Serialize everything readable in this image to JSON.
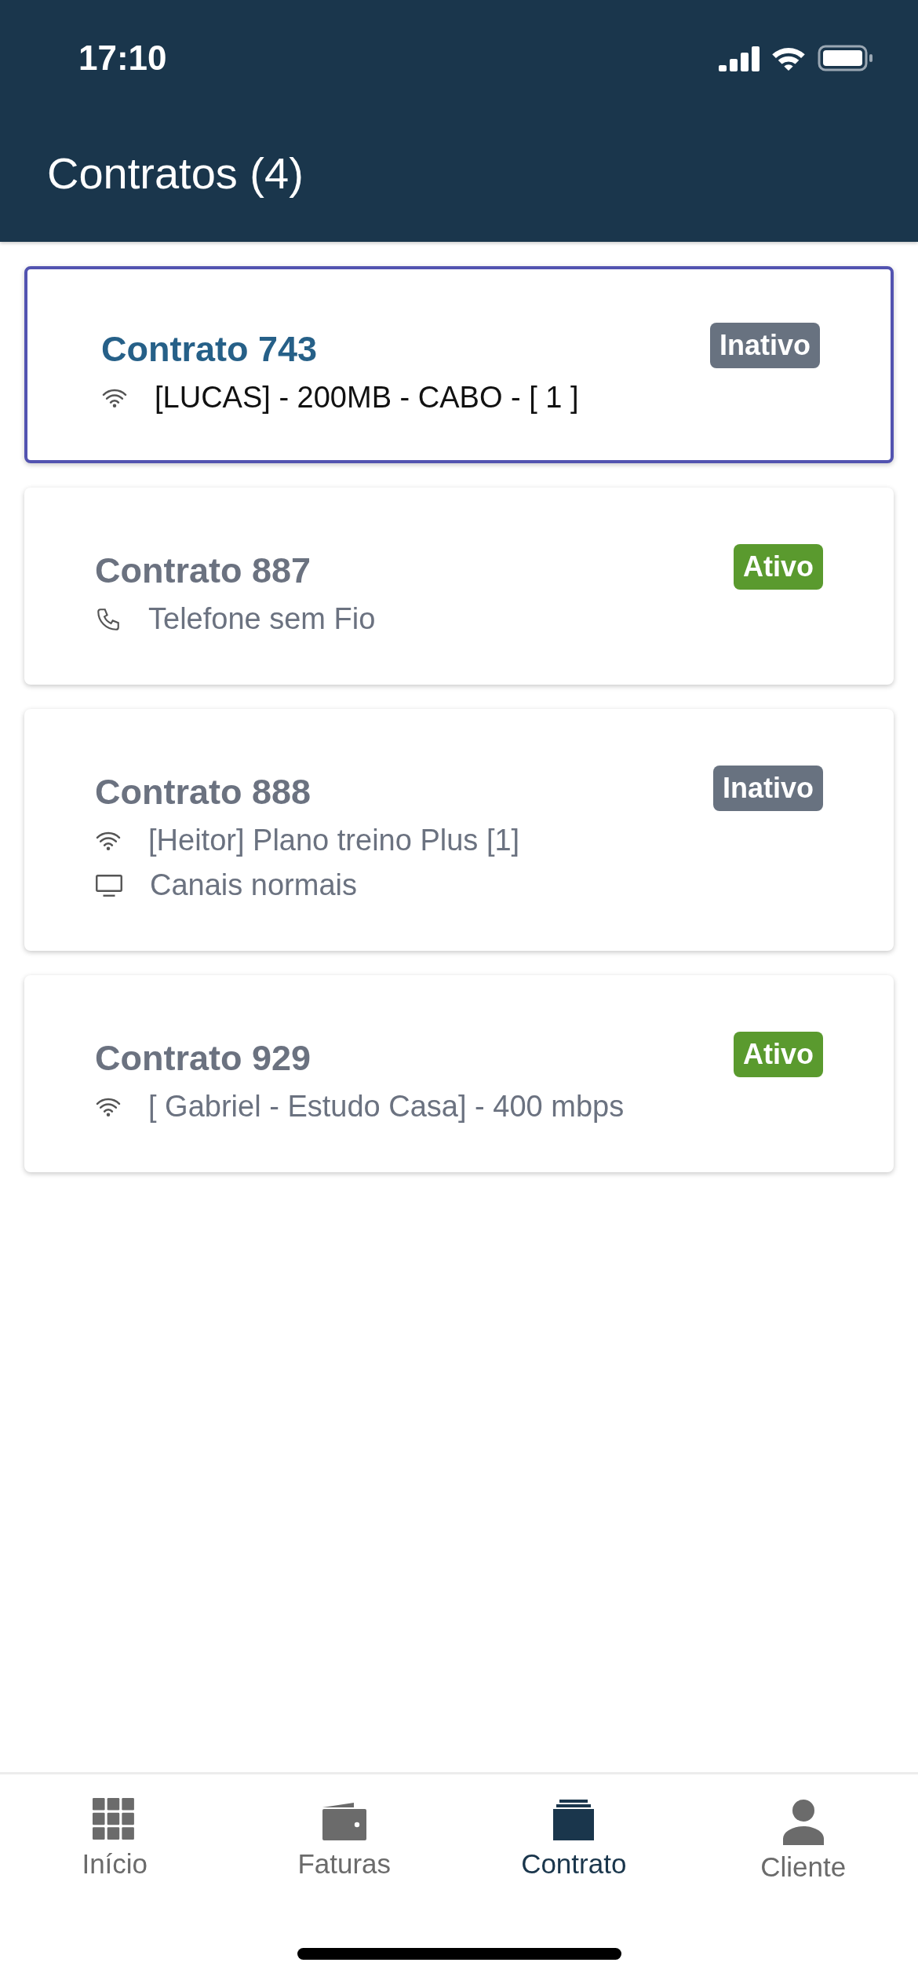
{
  "status_bar": {
    "time": "17:10"
  },
  "header": {
    "title": "Contratos (4)"
  },
  "contracts": [
    {
      "title": "Contrato 743",
      "selected": true,
      "badge": "Inativo",
      "active": false,
      "services": [
        {
          "kind": "wifi",
          "label": "[LUCAS] - 200MB - CABO - [ 1 ]"
        }
      ]
    },
    {
      "title": "Contrato 887",
      "selected": false,
      "badge": "Ativo",
      "active": true,
      "services": [
        {
          "kind": "phone",
          "label": "Telefone sem Fio"
        }
      ]
    },
    {
      "title": "Contrato 888",
      "selected": false,
      "badge": "Inativo",
      "active": false,
      "services": [
        {
          "kind": "wifi",
          "label": "[Heitor] Plano treino Plus [1]"
        },
        {
          "kind": "tv",
          "label": "Canais normais"
        }
      ]
    },
    {
      "title": "Contrato 929",
      "selected": false,
      "badge": "Ativo",
      "active": true,
      "services": [
        {
          "kind": "wifi",
          "label": "[ Gabriel - Estudo Casa] - 400 mbps"
        }
      ]
    }
  ],
  "tab_bar": [
    {
      "kind": "grid",
      "label": "Início",
      "selected": false
    },
    {
      "kind": "wallet",
      "label": "Faturas",
      "selected": false
    },
    {
      "kind": "stack",
      "label": "Contrato",
      "selected": true
    },
    {
      "kind": "person",
      "label": "Cliente",
      "selected": false
    }
  ]
}
